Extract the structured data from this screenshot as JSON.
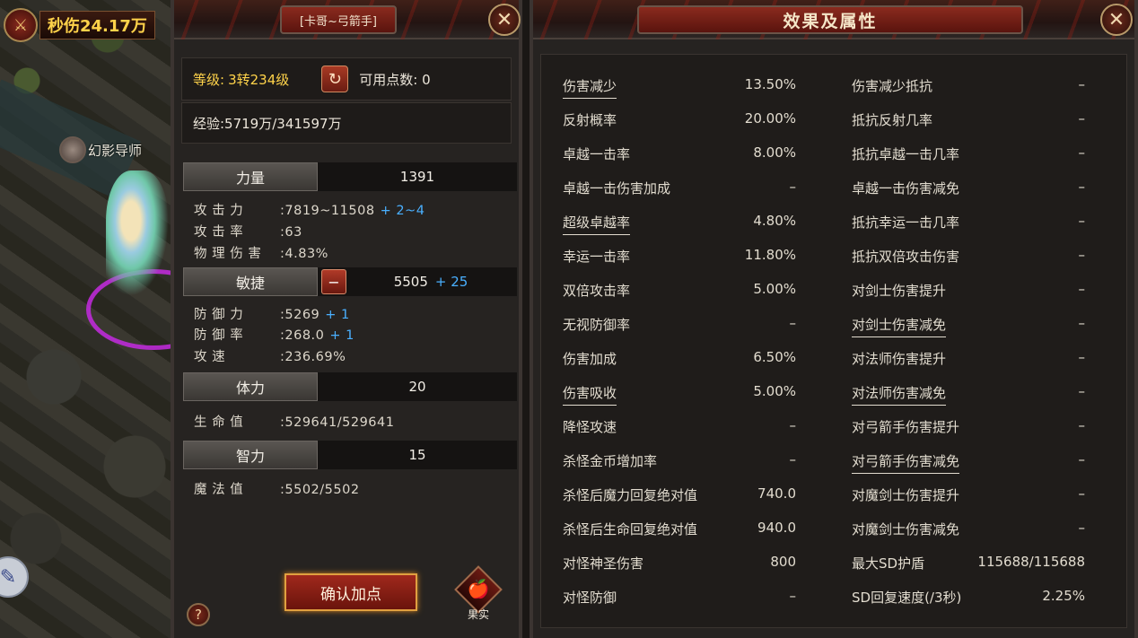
{
  "hud": {
    "dps_label": "秒伤24.17万",
    "npc_name": "幻影导师"
  },
  "char_panel": {
    "title": "[卡哥~弓箭手]",
    "level_label": "等级:",
    "level_value": "3转234级",
    "points_label": "可用点数: 0",
    "exp_label": "经验:5719万/341597万",
    "stats": [
      {
        "name": "力量",
        "value": "1391",
        "subs": [
          {
            "key": "攻 击 力",
            "val": ":7819~11508",
            "bonus": "+ 2~4"
          },
          {
            "key": "攻 击 率",
            "val": ":63",
            "bonus": ""
          },
          {
            "key": "物 理 伤 害",
            "val": ":4.83%",
            "bonus": ""
          }
        ]
      },
      {
        "name": "敏捷",
        "value": "5505",
        "bonus": "+ 25",
        "subs": [
          {
            "key": "防 御 力",
            "val": ":5269",
            "bonus": "+ 1"
          },
          {
            "key": "防 御 率",
            "val": ":268.0",
            "bonus": "+ 1"
          },
          {
            "key": "攻    速",
            "val": ":236.69%",
            "bonus": ""
          }
        ]
      },
      {
        "name": "体力",
        "value": "20",
        "subs": [
          {
            "key": "生 命 值",
            "val": ":529641/529641",
            "bonus": ""
          }
        ]
      },
      {
        "name": "智力",
        "value": "15",
        "subs": [
          {
            "key": "魔 法 值",
            "val": ":5502/5502",
            "bonus": ""
          }
        ]
      }
    ],
    "confirm_label": "确认加点",
    "fruit_label": "果实",
    "help_label": "?"
  },
  "attr_panel": {
    "title": "效果及属性",
    "left_col": [
      {
        "name": "伤害减少",
        "value": "13.50%",
        "u": true
      },
      {
        "name": "反射概率",
        "value": "20.00%"
      },
      {
        "name": "卓越一击率",
        "value": "8.00%"
      },
      {
        "name": "卓越一击伤害加成",
        "value": "–"
      },
      {
        "name": "超级卓越率",
        "value": "4.80%",
        "u": true
      },
      {
        "name": "幸运一击率",
        "value": "11.80%"
      },
      {
        "name": "双倍攻击率",
        "value": "5.00%"
      },
      {
        "name": "无视防御率",
        "value": "–"
      },
      {
        "name": "伤害加成",
        "value": "6.50%"
      },
      {
        "name": "伤害吸收",
        "value": "5.00%",
        "u": true
      },
      {
        "name": "降怪攻速",
        "value": "–"
      },
      {
        "name": "杀怪金币增加率",
        "value": "–"
      },
      {
        "name": "杀怪后魔力回复绝对值",
        "value": "740.0"
      },
      {
        "name": "杀怪后生命回复绝对值",
        "value": "940.0"
      },
      {
        "name": "对怪神圣伤害",
        "value": "800"
      },
      {
        "name": "对怪防御",
        "value": "–"
      }
    ],
    "right_col": [
      {
        "name": "伤害减少抵抗",
        "value": "–"
      },
      {
        "name": "抵抗反射几率",
        "value": "–"
      },
      {
        "name": "抵抗卓越一击几率",
        "value": "–"
      },
      {
        "name": "卓越一击伤害减免",
        "value": "–"
      },
      {
        "name": "抵抗幸运一击几率",
        "value": "–"
      },
      {
        "name": "抵抗双倍攻击伤害",
        "value": "–"
      },
      {
        "name": "对剑士伤害提升",
        "value": "–"
      },
      {
        "name": "对剑士伤害减免",
        "value": "–",
        "u": true
      },
      {
        "name": "对法师伤害提升",
        "value": "–"
      },
      {
        "name": "对法师伤害减免",
        "value": "–",
        "u": true
      },
      {
        "name": "对弓箭手伤害提升",
        "value": "–"
      },
      {
        "name": "对弓箭手伤害减免",
        "value": "–",
        "u": true
      },
      {
        "name": "对魔剑士伤害提升",
        "value": "–"
      },
      {
        "name": "对魔剑士伤害减免",
        "value": "–"
      },
      {
        "name": "最大SD护盾",
        "value": "115688/115688"
      },
      {
        "name": "SD回复速度(/3秒)",
        "value": "2.25%"
      }
    ]
  },
  "icons": {
    "close": "close-x-icon",
    "reset": "reset-arrow-icon",
    "minus": "minus-icon",
    "fruit": "apple-icon",
    "chat": "chat-icon"
  }
}
